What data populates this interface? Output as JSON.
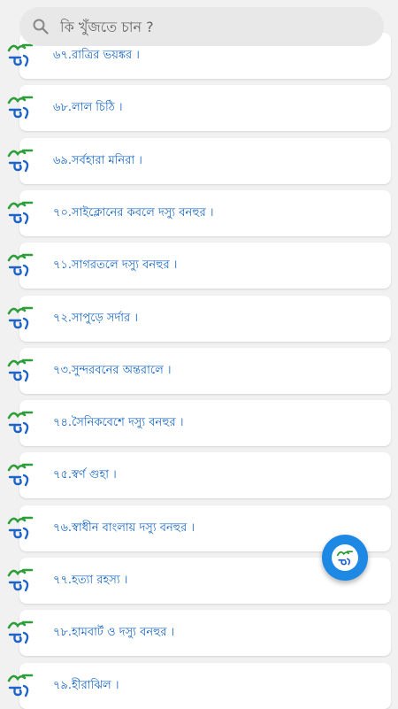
{
  "search": {
    "placeholder": "কি খুঁজতে চান ?"
  },
  "colors": {
    "title": "#1565c0",
    "fab": "#1e88e5",
    "logo_green": "#2e9e3a",
    "logo_blue": "#1e63c7"
  },
  "items": [
    {
      "label": "৬৭.রাত্রির ভয়ঙ্কর ।"
    },
    {
      "label": "৬৮.লাল চিঠি ।"
    },
    {
      "label": "৬৯.সর্বহারা মনিরা ।"
    },
    {
      "label": "৭০.সাইক্লোনের কবলে দস্যু বনহুর ।"
    },
    {
      "label": "৭১.সাগরতলে দস্যু বনহুর ।"
    },
    {
      "label": "৭২.সাপুড়ে সর্দার ।"
    },
    {
      "label": "৭৩.সুন্দরবনের অন্তরালে ।"
    },
    {
      "label": "৭৪.সৈনিকবেশে দস্যু বনহুর ।"
    },
    {
      "label": "৭৫.স্বর্ণ গুহা ।"
    },
    {
      "label": "৭৬.স্বাধীন বাংলায় দস্যু বনহুর ।"
    },
    {
      "label": "৭৭.হত্যা রহস্য ।"
    },
    {
      "label": "৭৮.হামবার্ট ও দস্যু বনহুর ।"
    },
    {
      "label": "৭৯.হীরাঝিল ।"
    }
  ]
}
